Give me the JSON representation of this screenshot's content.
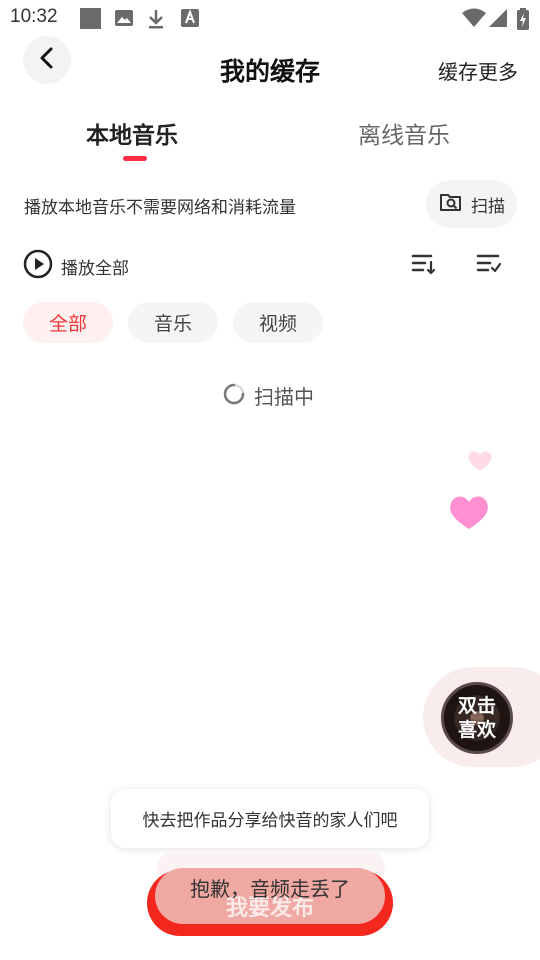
{
  "status_bar": {
    "time": "10:32",
    "icons": [
      "square-icon",
      "image-icon",
      "download-icon",
      "text-a-icon",
      "wifi-icon",
      "signal-icon",
      "battery-icon"
    ]
  },
  "header": {
    "title": "我的缓存",
    "more_label": "缓存更多",
    "back_icon": "back-arrow-icon"
  },
  "tabs": [
    {
      "label": "本地音乐",
      "active": true
    },
    {
      "label": "离线音乐",
      "active": false
    }
  ],
  "info": {
    "text": "播放本地音乐不需要网络和消耗流量",
    "scan_label": "扫描"
  },
  "play_all": {
    "label": "播放全部"
  },
  "filters": [
    {
      "label": "全部",
      "selected": true
    },
    {
      "label": "音乐",
      "selected": false
    },
    {
      "label": "视频",
      "selected": false
    }
  ],
  "scanning": {
    "label": "扫描中"
  },
  "like_widget": {
    "line1": "双击",
    "line2": "喜欢"
  },
  "share_toast": {
    "text": "快去把作品分享给快音的家人们吧"
  },
  "publish": {
    "label": "我要发布",
    "error_text": "抱歉，音频走丢了"
  },
  "colors": {
    "accent": "#ff2b45",
    "chip_selected_bg": "#fff0f0",
    "chip_selected_text": "#f0383c",
    "publish_red": "#f2281f",
    "heart_pink": "#ff8fd0"
  }
}
